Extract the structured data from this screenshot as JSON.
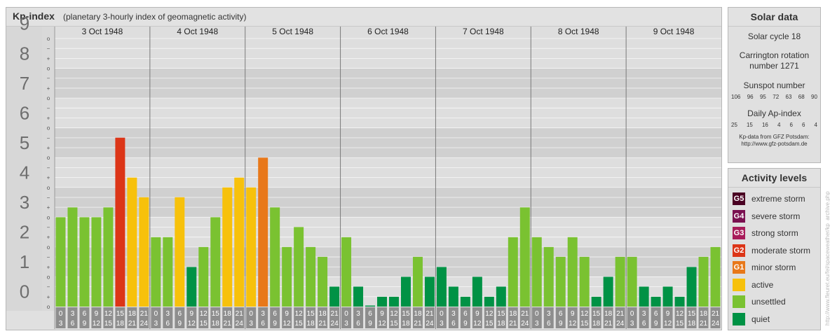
{
  "header": {
    "title": "Kp-index",
    "subtitle": "(planetary 3-hourly index of geomagnetic activity)"
  },
  "chart_data": {
    "type": "bar",
    "ylim": [
      0,
      9
    ],
    "y_major_ticks": [
      "0",
      "1",
      "2",
      "3",
      "4",
      "5",
      "6",
      "7",
      "8",
      "9"
    ],
    "y_minor_labels": [
      "+",
      "o",
      "−"
    ],
    "days": [
      "3 Oct 1948",
      "4 Oct 1948",
      "5 Oct 1948",
      "6 Oct 1948",
      "7 Oct 1948",
      "8 Oct 1948",
      "9 Oct 1948"
    ],
    "hour_ranges": [
      [
        "0",
        "3"
      ],
      [
        "3",
        "6"
      ],
      [
        "6",
        "9"
      ],
      [
        "9",
        "12"
      ],
      [
        "12",
        "15"
      ],
      [
        "15",
        "18"
      ],
      [
        "18",
        "21"
      ],
      [
        "21",
        "24"
      ]
    ],
    "values": [
      3.0,
      3.33,
      3.0,
      3.0,
      3.33,
      5.67,
      4.33,
      3.67,
      2.33,
      2.33,
      3.67,
      1.33,
      2.0,
      3.0,
      4.0,
      4.33,
      4.0,
      5.0,
      3.33,
      2.0,
      2.67,
      2.0,
      1.67,
      0.67,
      2.33,
      0.67,
      0.0,
      0.33,
      0.33,
      1.0,
      1.67,
      1.0,
      1.33,
      0.67,
      0.33,
      1.0,
      0.33,
      0.67,
      2.33,
      3.33,
      2.33,
      2.0,
      1.67,
      2.33,
      1.67,
      0.33,
      1.0,
      1.67,
      1.67,
      0.67,
      0.33,
      0.67,
      0.33,
      1.33,
      1.67,
      2.0
    ],
    "levels": [
      "unsettled",
      "unsettled",
      "unsettled",
      "unsettled",
      "unsettled",
      "moderate",
      "active",
      "active",
      "unsettled",
      "unsettled",
      "active",
      "quiet",
      "unsettled",
      "unsettled",
      "active",
      "active",
      "active",
      "minor",
      "unsettled",
      "unsettled",
      "unsettled",
      "unsettled",
      "unsettled",
      "quiet",
      "unsettled",
      "quiet",
      "quiet",
      "quiet",
      "quiet",
      "quiet",
      "unsettled",
      "quiet",
      "quiet",
      "quiet",
      "quiet",
      "quiet",
      "quiet",
      "quiet",
      "unsettled",
      "unsettled",
      "unsettled",
      "unsettled",
      "unsettled",
      "unsettled",
      "unsettled",
      "quiet",
      "quiet",
      "unsettled",
      "unsettled",
      "quiet",
      "quiet",
      "quiet",
      "quiet",
      "quiet",
      "unsettled",
      "unsettled"
    ],
    "level_colors": {
      "quiet": "#009245",
      "unsettled": "#7ac231",
      "active": "#f7c10b",
      "minor": "#e8781a",
      "moderate": "#dc3517",
      "strong": "#a81c5a",
      "severe": "#7a1050",
      "extreme": "#4a0022"
    }
  },
  "solar": {
    "heading": "Solar data",
    "cycle": "Solar cycle 18",
    "carrington_line1": "Carrington rotation",
    "carrington_line2": "number 1271",
    "sunspot_label": "Sunspot number",
    "sunspot_values": [
      "106",
      "96",
      "95",
      "72",
      "63",
      "68",
      "90"
    ],
    "ap_label": "Daily Ap-index",
    "ap_values": [
      "25",
      "15",
      "16",
      "4",
      "6",
      "6",
      "4"
    ],
    "source_line1": "Kp-data from GFZ Potsdam:",
    "source_line2": "http://www.gfz-potsdam.de"
  },
  "activity": {
    "heading": "Activity levels",
    "items": [
      {
        "code": "G5",
        "label": "extreme storm",
        "color": "#4a0022"
      },
      {
        "code": "G4",
        "label": "severe storm",
        "color": "#7a1050"
      },
      {
        "code": "G3",
        "label": "strong storm",
        "color": "#a81c5a"
      },
      {
        "code": "G2",
        "label": "moderate storm",
        "color": "#dc3517"
      },
      {
        "code": "G1",
        "label": "minor storm",
        "color": "#e8781a"
      },
      {
        "code": "",
        "label": "active",
        "color": "#f7c10b"
      },
      {
        "code": "",
        "label": "unsettled",
        "color": "#7ac231"
      },
      {
        "code": "",
        "label": "quiet",
        "color": "#009245"
      }
    ]
  },
  "watermark": "http://www.fleuret.eu/fel/spaceweather/kp_archive.php"
}
